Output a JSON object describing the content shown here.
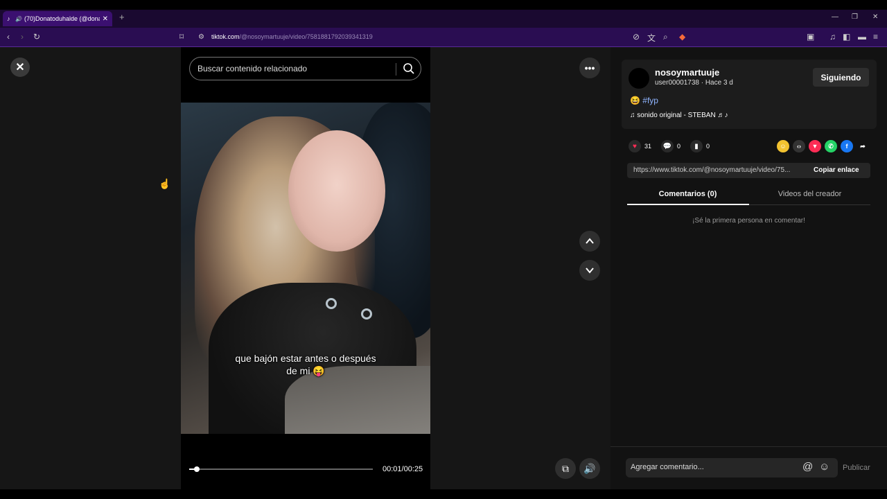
{
  "browser": {
    "tab_title": "(70)Donatoduhalde (@donat",
    "url_host": "tiktok.com",
    "url_path": "/@nosoymartuuje/video/7581881792039341319"
  },
  "search": {
    "placeholder": "Buscar contenido relacionado"
  },
  "video": {
    "caption_line1": "que bajón estar antes o después",
    "caption_line2": "de mi 😝",
    "current_time": "00:01",
    "duration": "00:25",
    "time_display": "00:01/00:25",
    "progress_fraction": 0.04
  },
  "post": {
    "username": "nosoymartuuje",
    "subline": "user00001738 · Hace 3 d",
    "follow_label": "Siguiendo",
    "hashtag_emoji": "😆",
    "hashtag": "#fyp",
    "sound_icon": "♫",
    "sound": "sonido original - STEBAN ♬♪",
    "likes": "31",
    "comments": "0",
    "saves": "0",
    "link": "https://www.tiktok.com/@nosoymartuuje/video/75...",
    "copy_label": "Copiar enlace"
  },
  "tabs": {
    "comments_tab": "Comentarios (0)",
    "creator_tab": "Videos del creador"
  },
  "comments": {
    "empty_message": "¡Sé la primera persona en comentar!",
    "placeholder": "Agregar comentario...",
    "publish_label": "Publicar"
  },
  "colors": {
    "like": "#fe2c55",
    "hashtag": "#8fb4ff",
    "browser_accent": "#3b1070"
  }
}
